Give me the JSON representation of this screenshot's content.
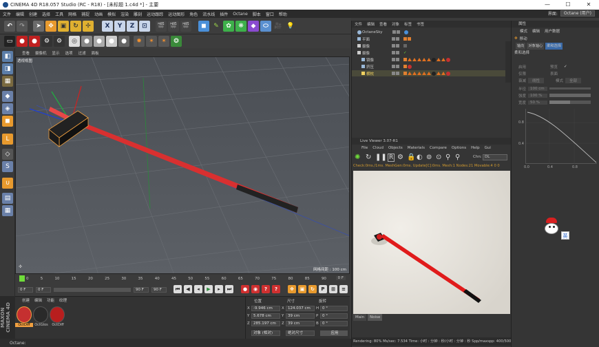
{
  "titlebar": {
    "title": "CINEMA 4D R18.057 Studio (RC - R18) - [未标题 1.c4d *] - 主要",
    "minimize": "—",
    "maximize": "☐",
    "close": "✕"
  },
  "menu": {
    "items": [
      "文件",
      "编辑",
      "创建",
      "选择",
      "工具",
      "网格",
      "捕捉",
      "动画",
      "模拟",
      "渲染",
      "雕刻",
      "运动跟踪",
      "运动图形",
      "角色",
      "流水线",
      "插件",
      "Octane",
      "脚本",
      "窗口",
      "帮助"
    ],
    "layout_label": "界面:",
    "layout_value": "Octane (用户)"
  },
  "viewport": {
    "menu": [
      "查看",
      "摄像机",
      "显示",
      "选项",
      "过滤",
      "面板"
    ],
    "name": "透视视图",
    "grid_label": "网格间距 : 100 cm"
  },
  "timeline": {
    "ticks": [
      "0",
      "5",
      "10",
      "15",
      "20",
      "25",
      "30",
      "35",
      "40",
      "45",
      "50",
      "55",
      "60",
      "65",
      "70",
      "75",
      "80",
      "85",
      "90"
    ],
    "end_label": "0 F"
  },
  "transport": {
    "start": "0 F",
    "current": "0 F",
    "end": "90 F",
    "end2": "90 F"
  },
  "materials": {
    "menu": [
      "创建",
      "编辑",
      "功能",
      "纹理"
    ],
    "items": [
      {
        "label": "OctDiff",
        "color": "#c53030"
      },
      {
        "label": "OctGlos",
        "color": "#2a2a2a"
      },
      {
        "label": "OctDiff",
        "color": "#b81e1e"
      }
    ],
    "brand": "MAXON CINEMA 4D"
  },
  "coords": {
    "headers": [
      "位置",
      "尺寸",
      "旋转"
    ],
    "rows": [
      {
        "axis": "X",
        "pos": "-9.946 cm",
        "size_axis": "X",
        "size": "124.037 cm",
        "rot_axis": "H",
        "rot": "0 °"
      },
      {
        "axis": "Y",
        "pos": "5.678 cm",
        "size_axis": "Y",
        "size": "39 cm",
        "rot_axis": "P",
        "rot": "0 °"
      },
      {
        "axis": "Z",
        "pos": "285.197 cm",
        "size_axis": "Z",
        "size": "39 cm",
        "rot_axis": "B",
        "rot": "0 °"
      }
    ],
    "mode1": "对象 (相对)",
    "mode2": "绝对尺寸",
    "apply": "应用"
  },
  "status": {
    "text": "Octane:"
  },
  "objects": {
    "menu": [
      "文件",
      "编辑",
      "查看",
      "对象",
      "标签",
      "书签"
    ],
    "rows": [
      {
        "name": "OctaneSky",
        "color": "#9ab8d8"
      },
      {
        "name": "平面",
        "color": "#9ab8d8"
      },
      {
        "name": "摄像",
        "color": "#cccccc"
      },
      {
        "name": "摄像",
        "color": "#cccccc"
      },
      {
        "name": "镜像",
        "color": "#9ab8d8"
      },
      {
        "name": "挤压",
        "color": "#9ab8d8"
      },
      {
        "name": "横枕",
        "color": "#f0d060"
      }
    ]
  },
  "liveviewer": {
    "title": "Live Viewer 3.07-R1",
    "menu": [
      "File",
      "Cloud",
      "Objects",
      "Materials",
      "Compare",
      "Options",
      "Help",
      "Gui"
    ],
    "chn_label": "Chn:",
    "chn_value": "DL",
    "info": "Check:0ms./1ms. MeshGen:0ms. Update[C]:0ms. Mesh:1 Nodes:21 Movable:4  0 0",
    "tabs": [
      "Main",
      "Noise"
    ],
    "render_status": "Rendering: 80%  Ms/sec: 7.534    Time: 小时 : 分钟 : 秒/小时 : 分钟 : 秒    Spp/maxspp: 400/500"
  },
  "attributes": {
    "title": "属性",
    "menu": [
      "模式",
      "编辑",
      "用户数据"
    ],
    "section": "移动",
    "tabs": [
      "轴向",
      "对象轴心",
      "柔和选择"
    ],
    "group": "柔和选择",
    "fields": [
      {
        "label": "启用",
        "value": ""
      },
      {
        "label": "预览",
        "value": "✓"
      },
      {
        "label": "仅限",
        "value": ""
      },
      {
        "label": "表面",
        "value": ""
      },
      {
        "label": "衰减",
        "value": "线性"
      },
      {
        "label": "模式",
        "value": "全部"
      },
      {
        "label": "半径",
        "value": "100 cm"
      },
      {
        "label": "强度",
        "value": "100 %"
      },
      {
        "label": "宽度",
        "value": "50 %"
      }
    ],
    "graph_ticks_y": [
      "0.8",
      "0.4"
    ],
    "graph_ticks_x": [
      "0.0",
      "0.4",
      "0.8"
    ]
  },
  "badge": {
    "text": "英"
  }
}
